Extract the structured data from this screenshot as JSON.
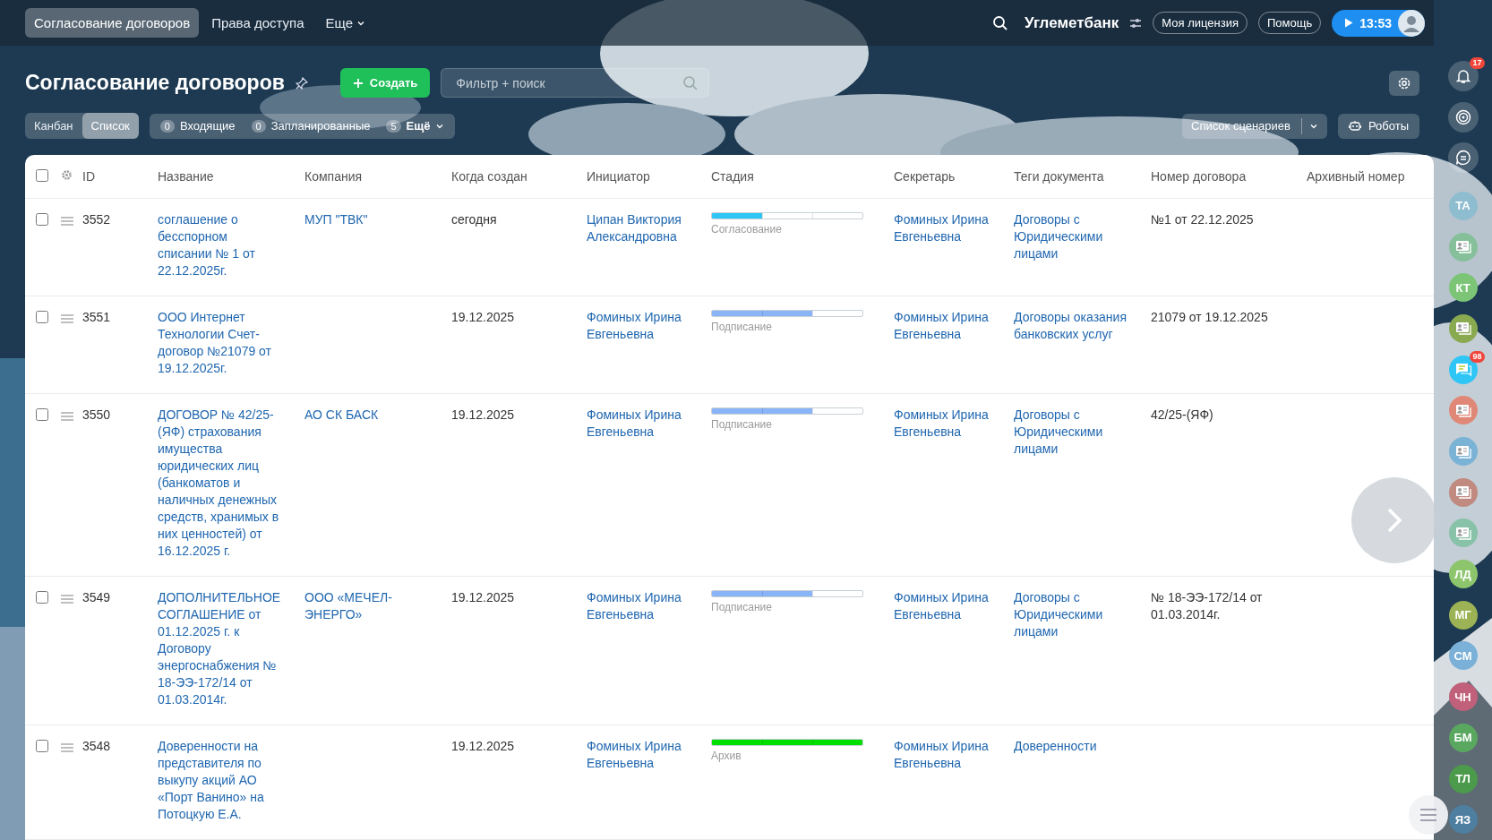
{
  "top_nav": {
    "tabs": [
      {
        "label": "Согласование договоров",
        "selected": true
      },
      {
        "label": "Права доступа",
        "selected": false
      },
      {
        "label": "Еще",
        "selected": false
      }
    ],
    "company": "Углеметбанк",
    "license_button": "Моя лицензия",
    "help_button": "Помощь",
    "time": "13:53"
  },
  "header": {
    "title": "Согласование договоров",
    "create_button": "Создать",
    "search": {
      "placeholder": "Фильтр + поиск"
    }
  },
  "toolbar": {
    "views": [
      {
        "label": "Канбан",
        "selected": false
      },
      {
        "label": "Список",
        "selected": true
      }
    ],
    "counters": [
      {
        "count": "0",
        "label": "Входящие"
      },
      {
        "count": "0",
        "label": "Запланированные"
      },
      {
        "count": "5",
        "label": "Ещё"
      }
    ],
    "scenarios_button": "Список сценариев",
    "robots_button": "Роботы"
  },
  "table": {
    "select_all": {
      "checked": false
    },
    "columns": [
      "ID",
      "Название",
      "Компания",
      "Когда создан",
      "Инициатор",
      "Стадия",
      "Секретарь",
      "Теги документа",
      "Номер договора",
      "Архивный номер"
    ],
    "rows": [
      {
        "checked": false,
        "id": "3552",
        "title": "соглашение о бесспорном списании № 1 от 22.12.2025г.",
        "company": "МУП \"ТВК\"",
        "created": "сегодня",
        "initiator": "Ципан Виктория Александровна",
        "stage": {
          "label": "Согласование",
          "level": 0.333,
          "color": "#2fc6f6"
        },
        "secretary": "Фоминых Ирина Евгеньевна",
        "tags": "Договоры с Юридическими лицами",
        "contract_number": "№1 от 22.12.2025"
      },
      {
        "checked": false,
        "id": "3551",
        "title": "ООО Интернет Технологии Счет-договор №21079 от 19.12.2025г.",
        "created": "19.12.2025",
        "initiator": "Фоминых Ирина Евгеньевна",
        "stage": {
          "label": "Подписание",
          "level": 0.667,
          "color": "#8ab4f8"
        },
        "secretary": "Фоминых Ирина Евгеньевна",
        "tags": "Договоры оказания банковских услуг",
        "contract_number": "21079 от 19.12.2025"
      },
      {
        "checked": false,
        "id": "3550",
        "title": "ДОГОВОР № 42/25-(ЯФ) страхования имущества юридических лиц (банкоматов и наличных денежных средств, хранимых в них ценностей) от 16.12.2025 г.",
        "company": "АО СК БАСК",
        "created": "19.12.2025",
        "initiator": "Фоминых Ирина Евгеньевна",
        "stage": {
          "label": "Подписание",
          "level": 0.667,
          "color": "#8ab4f8"
        },
        "secretary": "Фоминых Ирина Евгеньевна",
        "tags": "Договоры с Юридическими лицами",
        "contract_number": "42/25-(ЯФ)"
      },
      {
        "checked": false,
        "id": "3549",
        "title": "ДОПОЛНИТЕЛЬНОЕ СОГЛАШЕНИЕ от 01.12.2025 г. к Договору энергоснабжения № 18-ЭЭ-172/14 от 01.03.2014г.",
        "company": "ООО «МЕЧЕЛ-ЭНЕРГО»",
        "created": "19.12.2025",
        "initiator": "Фоминых Ирина Евгеньевна",
        "stage": {
          "label": "Подписание",
          "level": 0.667,
          "color": "#8ab4f8"
        },
        "secretary": "Фоминых Ирина Евгеньевна",
        "tags": "Договоры с Юридическими лицами",
        "contract_number": "№ 18-ЭЭ-172/14 от 01.03.2014г."
      },
      {
        "checked": false,
        "id": "3548",
        "title": "Доверенности на представителя по выкупу акций АО «Порт Ванино» на Потоцкую Е.А.",
        "created": "19.12.2025",
        "initiator": "Фоминых Ирина Евгеньевна",
        "stage": {
          "label": "Архив",
          "level": 1,
          "color": "#00e000"
        },
        "secretary": "Фоминых Ирина Евгеньевна",
        "tags": "Доверенности"
      }
    ]
  },
  "right_sidebar": [
    {
      "kind": "bell",
      "badge": "17"
    },
    {
      "kind": "target"
    },
    {
      "kind": "chat"
    },
    {
      "kind": "initials",
      "initials": "ТА",
      "color": "#8fbdd0"
    },
    {
      "kind": "card",
      "color": "#86c09a"
    },
    {
      "kind": "initials",
      "initials": "КТ",
      "color": "#7cc576"
    },
    {
      "kind": "card",
      "color": "#8aaa52"
    },
    {
      "kind": "messenger",
      "badge": "98",
      "color": "#2fc6f6"
    },
    {
      "kind": "card",
      "color": "#e08878"
    },
    {
      "kind": "card",
      "color": "#7ab3d6"
    },
    {
      "kind": "card",
      "color": "#c08a80"
    },
    {
      "kind": "card",
      "color": "#88c2a8"
    },
    {
      "kind": "initials",
      "initials": "ЛД",
      "color": "#8dc56c"
    },
    {
      "kind": "initials",
      "initials": "МГ",
      "color": "#9bb354"
    },
    {
      "kind": "initials",
      "initials": "СМ",
      "color": "#7bb0d8"
    },
    {
      "kind": "initials",
      "initials": "ЧН",
      "color": "#c0607a"
    },
    {
      "kind": "initials",
      "initials": "БМ",
      "color": "#5aa860"
    },
    {
      "kind": "initials",
      "initials": "ТЛ",
      "color": "#4c9a4c"
    },
    {
      "kind": "initials",
      "initials": "ЯЗ",
      "color": "#4e7ea0"
    }
  ]
}
